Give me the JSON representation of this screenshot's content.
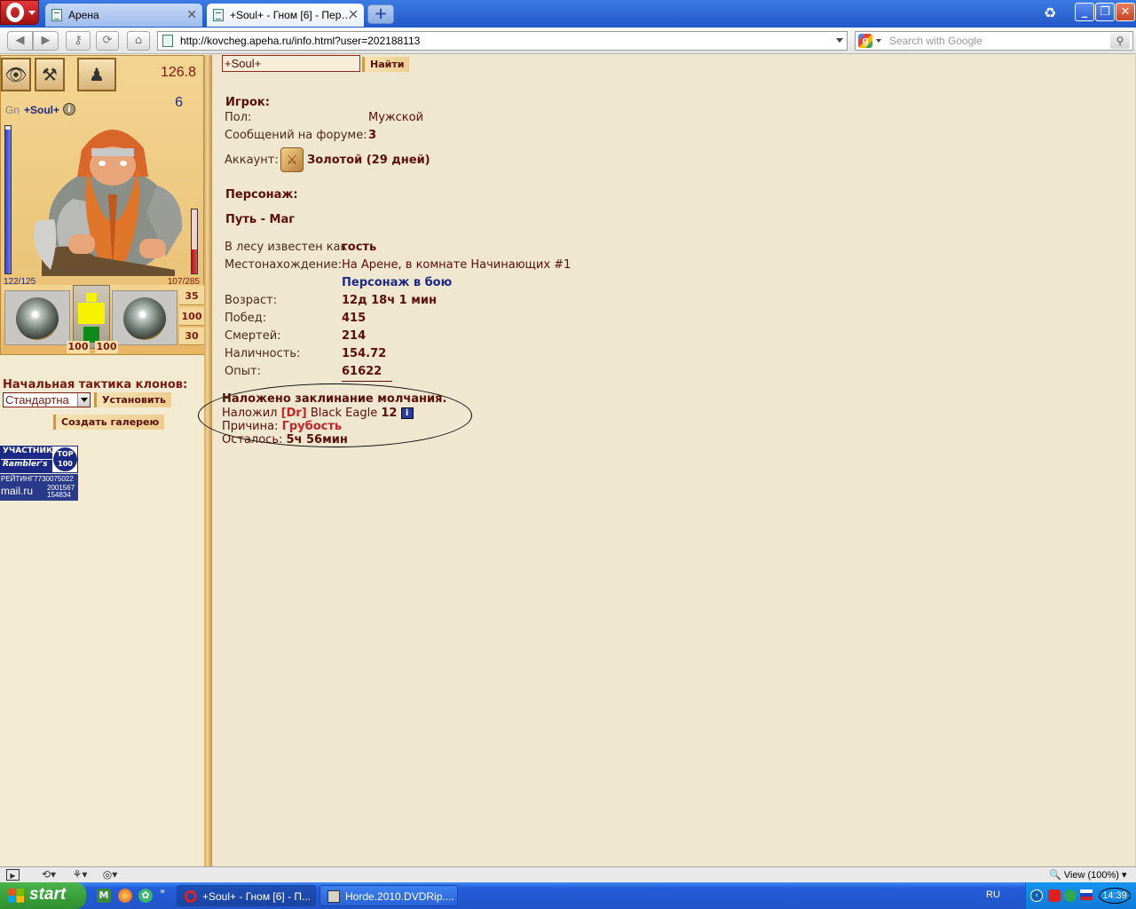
{
  "browser": {
    "tabs": [
      {
        "label": "Арена"
      },
      {
        "label": "+Soul+ - Гном [6] - Пер…"
      }
    ],
    "address_url": "http://kovcheg.apeha.ru/info.html?user=202188113",
    "search_placeholder": "Search with Google",
    "window_buttons": {
      "min": "_",
      "max": "❐",
      "close": "✕"
    },
    "new_tab": "+"
  },
  "left_panel": {
    "weight": "126.8",
    "level": "6",
    "race": "Gn",
    "nick": "+Soul+",
    "info": "i",
    "hp_text": "122/125",
    "mp_text": "107/285",
    "hp_level": 0.976,
    "mp_level": 0.375,
    "durability": [
      "100",
      "100"
    ],
    "stats": [
      "35",
      "100",
      "30"
    ],
    "tactics_label": "Начальная тактика клонов:",
    "tactics_value": "Стандартна",
    "set_button": "Установить",
    "gallery_button": "Создать галерею",
    "rambler": {
      "top": "УЧАСТНИК",
      "bottom": "Rambler's",
      "badge": "TOP 100"
    },
    "mailru": {
      "row1": "РЕЙТИНГ7730075022",
      "logo": "mail.ru",
      "row2": "2001567",
      "row3": "154834"
    }
  },
  "content": {
    "search_value": "+Soul+",
    "find_button": "Найти",
    "player_heading": "Игрок:",
    "gender_label": "Пол:",
    "gender_value": "Мужской",
    "forum_label": "Сообщений на форуме:",
    "forum_value": "3",
    "account_label": "Аккаунт:",
    "account_value": "Золотой (29 дней)",
    "character_heading": "Персонаж:",
    "path": "Путь - Маг",
    "forest_label": "В лесу известен как",
    "forest_value": "гость",
    "location_label": "Местонахождение:",
    "location_value": "На Арене, в комнате Начинающих #1",
    "battle_status": "Персонаж в бою",
    "age_label": "Возраст:",
    "age_value": "12д 18ч 1 мин",
    "wins_label": "Побед:",
    "wins_value": "415",
    "deaths_label": "Смертей:",
    "deaths_value": "214",
    "cash_label": "Наличность:",
    "cash_value": "154.72",
    "exp_label": "Опыт:",
    "exp_value": "61622",
    "silence": {
      "title": "Наложено заклинание молчания.",
      "by_label": "Наложил",
      "by_clan": "[Dr]",
      "by_name": "Black Eagle",
      "by_level": "12",
      "info": "i",
      "reason_label": "Причина:",
      "reason_value": "Грубость",
      "left_label": "Осталось:",
      "left_value": "5ч 56мин"
    }
  },
  "statusbar": {
    "zoom": "View (100%)"
  },
  "taskbar": {
    "start": "start",
    "tasks": [
      {
        "label": "+Soul+ - Гном [6] - П..."
      },
      {
        "label": "Horde.2010.DVDRip...."
      }
    ],
    "lang": "RU",
    "clock": "14:39"
  }
}
